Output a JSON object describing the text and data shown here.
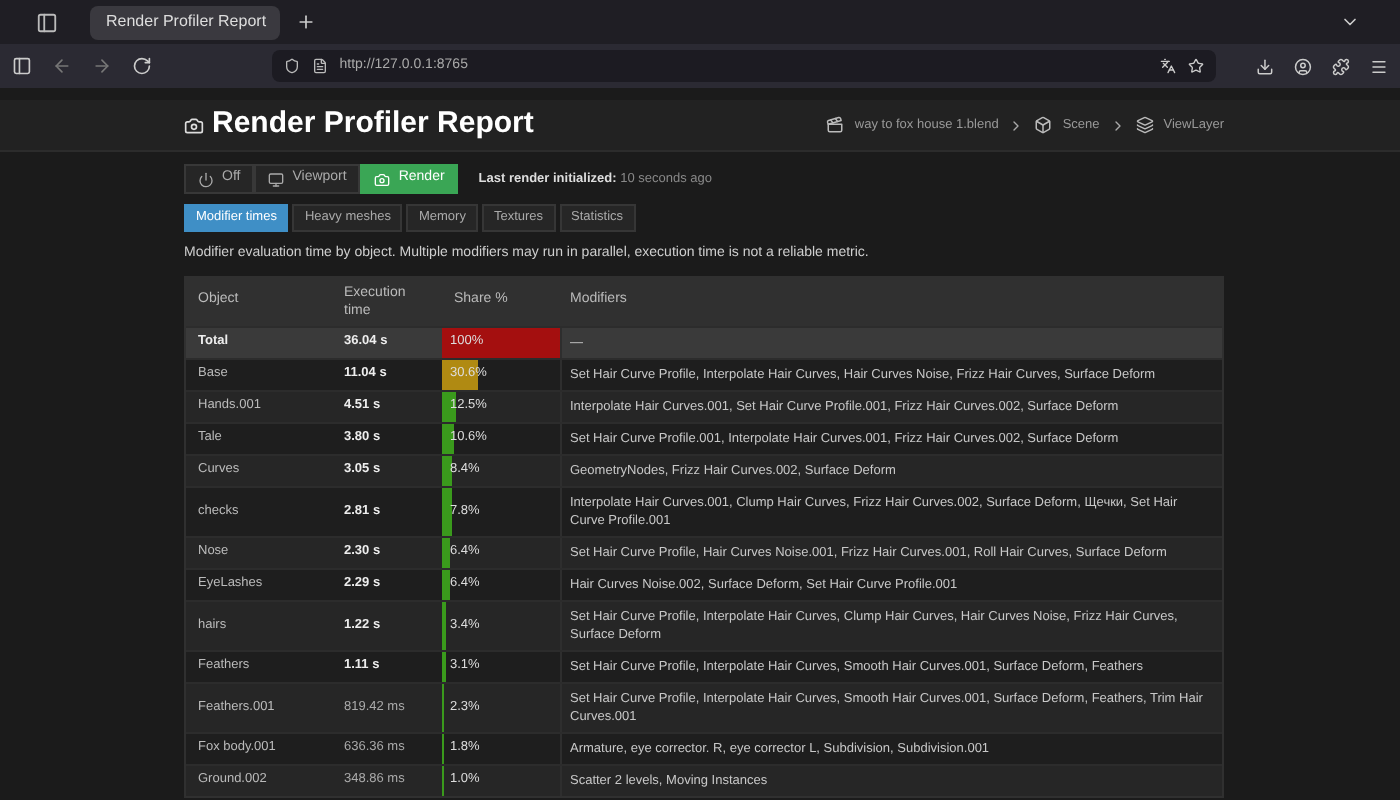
{
  "browser": {
    "tab_title": "Render Profiler Report",
    "url": "http://127.0.0.1:8765"
  },
  "header": {
    "title": "Render Profiler Report",
    "breadcrumb": [
      "way to fox house 1.blend",
      "Scene",
      "ViewLayer"
    ]
  },
  "modes": [
    {
      "label": "Off",
      "kind": "power",
      "selected": false
    },
    {
      "label": "Viewport",
      "kind": "monitor",
      "selected": false
    },
    {
      "label": "Render",
      "kind": "camera",
      "selected": true
    }
  ],
  "last_render": {
    "label": "Last render initialized:",
    "value": "10 seconds ago"
  },
  "tabs": [
    {
      "label": "Modifier times",
      "selected": true
    },
    {
      "label": "Heavy meshes",
      "selected": false
    },
    {
      "label": "Memory",
      "selected": false
    },
    {
      "label": "Textures",
      "selected": false
    },
    {
      "label": "Statistics",
      "selected": false
    }
  ],
  "description": "Modifier evaluation time by object. Multiple modifiers may run in parallel, execution time is not a reliable metric.",
  "table": {
    "columns": [
      "Object",
      "Execution time",
      "Share %",
      "Modifiers"
    ],
    "rows": [
      {
        "object": "Total",
        "time": "36.04 s",
        "share": "100%",
        "level": 1,
        "modifiers": "—",
        "total": true,
        "bold_time": true
      },
      {
        "object": "Base",
        "time": "11.04 s",
        "share": "30.6%",
        "level": 0.306,
        "modifiers": "Set Hair Curve Profile, Interpolate Hair Curves, Hair Curves Noise, Frizz Hair Curves, Surface Deform",
        "total": false,
        "bold_time": true
      },
      {
        "object": "Hands.001",
        "time": "4.51 s",
        "share": "12.5%",
        "level": 0.125,
        "modifiers": "Interpolate Hair Curves.001, Set Hair Curve Profile.001, Frizz Hair Curves.002, Surface Deform",
        "total": false,
        "bold_time": true
      },
      {
        "object": "Tale",
        "time": "3.80 s",
        "share": "10.6%",
        "level": 0.106,
        "modifiers": "Set Hair Curve Profile.001, Interpolate Hair Curves.001, Frizz Hair Curves.002, Surface Deform",
        "total": false,
        "bold_time": true
      },
      {
        "object": "Curves",
        "time": "3.05 s",
        "share": "8.4%",
        "level": 0.084,
        "modifiers": "GeometryNodes, Frizz Hair Curves.002, Surface Deform",
        "total": false,
        "bold_time": true
      },
      {
        "object": "checks",
        "time": "2.81 s",
        "share": "7.8%",
        "level": 0.078,
        "modifiers": "Interpolate Hair Curves.001, Clump Hair Curves, Frizz Hair Curves.002, Surface Deform, Щечки, Set Hair Curve Profile.001",
        "total": false,
        "bold_time": true
      },
      {
        "object": "Nose",
        "time": "2.30 s",
        "share": "6.4%",
        "level": 0.064,
        "modifiers": "Set Hair Curve Profile, Hair Curves Noise.001, Frizz Hair Curves.001, Roll Hair Curves, Surface Deform",
        "total": false,
        "bold_time": true
      },
      {
        "object": "EyeLashes",
        "time": "2.29 s",
        "share": "6.4%",
        "level": 0.064,
        "modifiers": "Hair Curves Noise.002, Surface Deform, Set Hair Curve Profile.001",
        "total": false,
        "bold_time": true
      },
      {
        "object": "hairs",
        "time": "1.22 s",
        "share": "3.4%",
        "level": 0.034,
        "modifiers": "Set Hair Curve Profile, Interpolate Hair Curves, Clump Hair Curves, Hair Curves Noise, Frizz Hair Curves, Surface Deform",
        "total": false,
        "bold_time": true
      },
      {
        "object": "Feathers",
        "time": "1.11 s",
        "share": "3.1%",
        "level": 0.031,
        "modifiers": "Set Hair Curve Profile, Interpolate Hair Curves, Smooth Hair Curves.001, Surface Deform, Feathers",
        "total": false,
        "bold_time": true
      },
      {
        "object": "Feathers.001",
        "time": "819.42 ms",
        "share": "2.3%",
        "level": 0.023,
        "modifiers": "Set Hair Curve Profile, Interpolate Hair Curves, Smooth Hair Curves.001, Surface Deform, Feathers, Trim Hair Curves.001",
        "total": false,
        "bold_time": false
      },
      {
        "object": "Fox body.001",
        "time": "636.36 ms",
        "share": "1.8%",
        "level": 0.018,
        "modifiers": "Armature, eye corrector. R, eye corrector L, Subdivision, Subdivision.001",
        "total": false,
        "bold_time": false
      },
      {
        "object": "Ground.002",
        "time": "348.86 ms",
        "share": "1.0%",
        "level": 0.01,
        "modifiers": "Scatter 2 levels, Moving Instances",
        "total": false,
        "bold_time": false
      }
    ]
  }
}
